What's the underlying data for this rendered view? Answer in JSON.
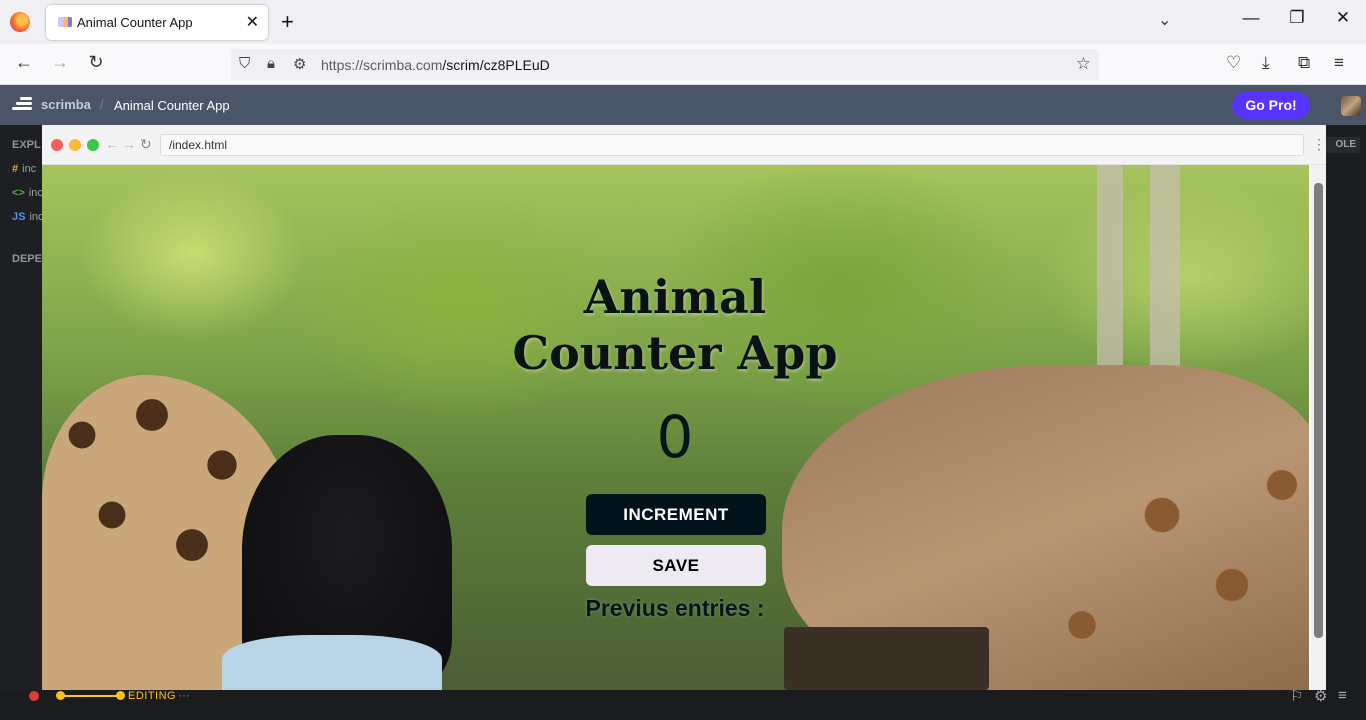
{
  "browser": {
    "tab_title": "Animal Counter App",
    "tab_close": "✕",
    "new_tab": "+",
    "url_host": "https://scrimba.com",
    "url_path": "/scrim/cz8PLEuD"
  },
  "scrimba": {
    "brand": "scrimba",
    "separator": "/",
    "title": "Animal Counter App",
    "go_pro": "Go Pro!"
  },
  "sidebar": {
    "explorer_head": "EXPL",
    "dependencies_head": "DEPE",
    "files": [
      {
        "icon": "#",
        "name": "inc"
      },
      {
        "icon": "<>",
        "name": "inc"
      },
      {
        "icon": "JS",
        "name": "inc"
      }
    ],
    "console_label": "OLE"
  },
  "preview": {
    "address": "/index.html"
  },
  "app": {
    "title_line1": "Animal",
    "title_line2": "Counter App",
    "count": "0",
    "increment_label": "INCREMENT",
    "save_label": "SAVE",
    "previous_label": "Previus entries :"
  },
  "status": {
    "mode": "EDITING",
    "more": "···"
  },
  "colors": {
    "go_pro_bg": "#5834ff",
    "accent_yellow": "#ffc21a",
    "increment_bg": "#02121a",
    "save_bg": "#eeeaf2"
  }
}
